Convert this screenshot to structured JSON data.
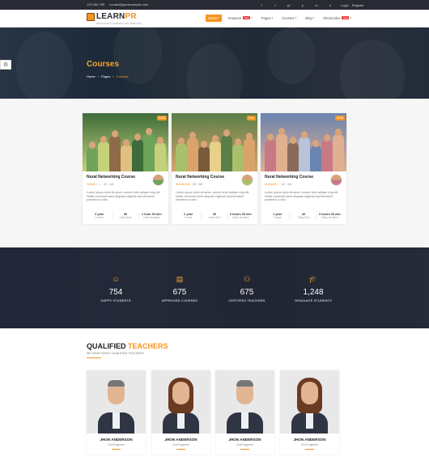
{
  "topbar": {
    "phone": "123 456 789",
    "email": "contact@jamiexample.com",
    "socials": [
      "f",
      "t",
      "g+",
      "p",
      "in",
      "s"
    ],
    "login": "Login",
    "register": "Register"
  },
  "brand": {
    "name_a": "LEARN",
    "name_b": "PR",
    "tagline": "EDUCATION & LEARNING PSD TEMPLATE"
  },
  "nav": [
    {
      "label": "Home",
      "active": true,
      "new": false
    },
    {
      "label": "Features",
      "active": false,
      "new": true
    },
    {
      "label": "Pages",
      "active": false,
      "new": false
    },
    {
      "label": "Courses",
      "active": false,
      "new": false
    },
    {
      "label": "Blog",
      "active": false,
      "new": false
    },
    {
      "label": "Shortcodes",
      "active": false,
      "new": true
    }
  ],
  "new_badge": "New",
  "hero": {
    "title": "Courses",
    "breadcrumb": [
      "Home",
      "Pages",
      "Courses"
    ]
  },
  "courses": [
    {
      "tag": "$29$",
      "title": "Nural Networking Course",
      "rating": "29",
      "reviews": "68",
      "stars": 2.5,
      "desc": "Lorem ipsum dolor sit amet, consec tetur adipisc cing elit. Nobis commodi eveni aliquam eligendi reprehenderit possimus a odio.",
      "stats": [
        {
          "v": "3 year",
          "l": "Course"
        },
        {
          "v": "80",
          "l": "Class Size"
        },
        {
          "v": "1 hour 30 min",
          "l": "Class Duration"
        }
      ]
    },
    {
      "tag": "Free",
      "title": "Nural Networking Course",
      "rating": "33",
      "reviews": "66",
      "stars": 5,
      "desc": "Lorem ipsum dolor sit amet, consec tetur adipisc cing elit. Nobis commodi eveni aliquam eligendi reprehenderit possimus a odio.",
      "stats": [
        {
          "v": "2 year",
          "l": "Course"
        },
        {
          "v": "30",
          "l": "Class Size"
        },
        {
          "v": "2 hours 30 min",
          "l": "Class Duration"
        }
      ]
    },
    {
      "tag": "$39$",
      "title": "Nural Networking Course",
      "rating": "41",
      "reviews": "63",
      "stars": 4,
      "desc": "Lorem ipsum dolor sit amet, consec tetur adipisc cing elit. Nobis commodi eveni aliquam eligendi reprehenderit possimus a odio.",
      "stats": [
        {
          "v": "1 year",
          "l": "Course"
        },
        {
          "v": "40",
          "l": "Class Size"
        },
        {
          "v": "3 hours 30 min",
          "l": "Class Duration"
        }
      ]
    }
  ],
  "counters": [
    {
      "num": "754",
      "label": "HAPPY STUDENTS",
      "icon": "smile-icon"
    },
    {
      "num": "675",
      "label": "APPROVED COURSES",
      "icon": "book-icon"
    },
    {
      "num": "675",
      "label": "CERTIFIED TEACHERS",
      "icon": "teacher-icon"
    },
    {
      "num": "1,248",
      "label": "GRADUATE STUDENTS",
      "icon": "graduation-cap-icon"
    }
  ],
  "teachers_section": {
    "title_a": "QUALIFIED",
    "title_b": "TEACHERS",
    "subtitle": "WE HAVE HIGHLY QUALIFIED TEACHERS"
  },
  "teachers": [
    {
      "name": "JHON ANDERSON",
      "role": "Civil Engineer",
      "gender": "m"
    },
    {
      "name": "JHON ANDERSON",
      "role": "Civil Engineer",
      "gender": "f"
    },
    {
      "name": "JHON ANDERSON",
      "role": "Civil Engineer",
      "gender": "m"
    },
    {
      "name": "JHON ANDERSON",
      "role": "Civil Engineer",
      "gender": "f"
    }
  ],
  "colors": {
    "accent": "#f7941d",
    "dark": "#2a2a34"
  }
}
